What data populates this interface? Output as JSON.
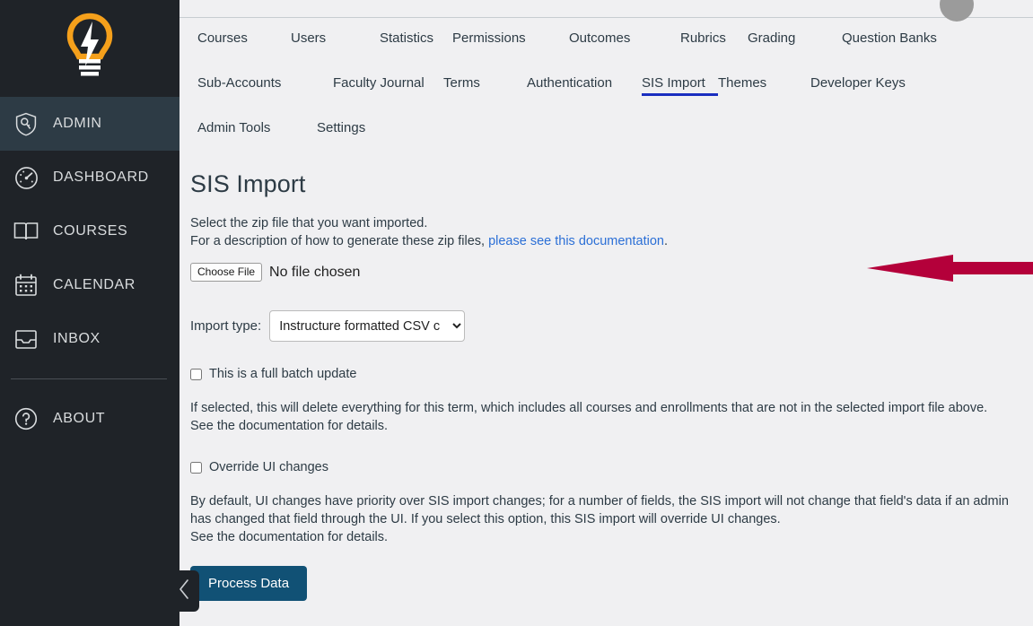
{
  "global_nav": {
    "logo_icon": "lightbulb-logo",
    "items": [
      {
        "label": "ADMIN",
        "icon": "shield-key-icon",
        "active": true
      },
      {
        "label": "DASHBOARD",
        "icon": "speedometer-icon",
        "active": false
      },
      {
        "label": "COURSES",
        "icon": "open-book-icon",
        "active": false
      },
      {
        "label": "CALENDAR",
        "icon": "calendar-icon",
        "active": false
      },
      {
        "label": "INBOX",
        "icon": "inbox-tray-icon",
        "active": false
      },
      {
        "label": "ABOUT",
        "icon": "question-circle-icon",
        "active": false
      }
    ]
  },
  "header": {
    "avatar": "user-avatar"
  },
  "tabs": {
    "rows": [
      [
        {
          "label": "Courses",
          "active": false
        },
        {
          "label": "Users",
          "active": false
        },
        {
          "label": "Statistics",
          "active": false
        },
        {
          "label": "Permissions",
          "active": false
        },
        {
          "label": "Outcomes",
          "active": false
        },
        {
          "label": "Rubrics",
          "active": false
        },
        {
          "label": "Grading",
          "active": false
        },
        {
          "label": "Question Banks",
          "active": false
        }
      ],
      [
        {
          "label": "Sub-Accounts",
          "active": false
        },
        {
          "label": "Faculty Journal",
          "active": false
        },
        {
          "label": "Terms",
          "active": false
        },
        {
          "label": "Authentication",
          "active": false
        },
        {
          "label": "SIS Import",
          "active": true
        },
        {
          "label": "Themes",
          "active": false
        },
        {
          "label": "Developer Keys",
          "active": false
        }
      ],
      [
        {
          "label": "Admin Tools",
          "active": false
        },
        {
          "label": "Settings",
          "active": false
        }
      ]
    ]
  },
  "content": {
    "page_title": "SIS Import",
    "intro_line1": "Select the zip file that you want imported.",
    "intro_line2_prefix": "For a description of how to generate these zip files, ",
    "intro_link_text": "please see this documentation",
    "intro_line2_suffix": ".",
    "file_input": {
      "button_label": "Choose File",
      "status_text": "No file chosen"
    },
    "import_type": {
      "label": "Import type:",
      "selected": "Instructure formatted CSV c",
      "options": [
        "Instructure formatted CSV c"
      ]
    },
    "batch_update": {
      "label": "This is a full batch update",
      "checked": false,
      "description_line1": "If selected, this will delete everything for this term, which includes all courses and enrollments that are not in the selected import file above.",
      "description_line2": "See the documentation for details."
    },
    "override_ui": {
      "label": "Override UI changes",
      "checked": false,
      "description_line1": "By default, UI changes have priority over SIS import changes; for a number of fields, the SIS import will not change that field's data if an admin",
      "description_line2": "has changed that field through the UI. If you select this option, this SIS import will override UI changes.",
      "description_line3": "See the documentation for details."
    },
    "process_button": "Process Data"
  },
  "collapse_handle": {
    "icon": "chevron-left-icon"
  },
  "annotation": {
    "arrow_icon": "left-pointing-arrow",
    "color": "#b4003a"
  },
  "colors": {
    "nav_background": "#1f2328",
    "nav_active": "#2d3b45",
    "content_background": "#f0f0f2",
    "tab_active_underline": "#1a2ec0",
    "link": "#2b6fd6",
    "primary_button": "#115175",
    "logo_accent": "#f5a01b"
  }
}
